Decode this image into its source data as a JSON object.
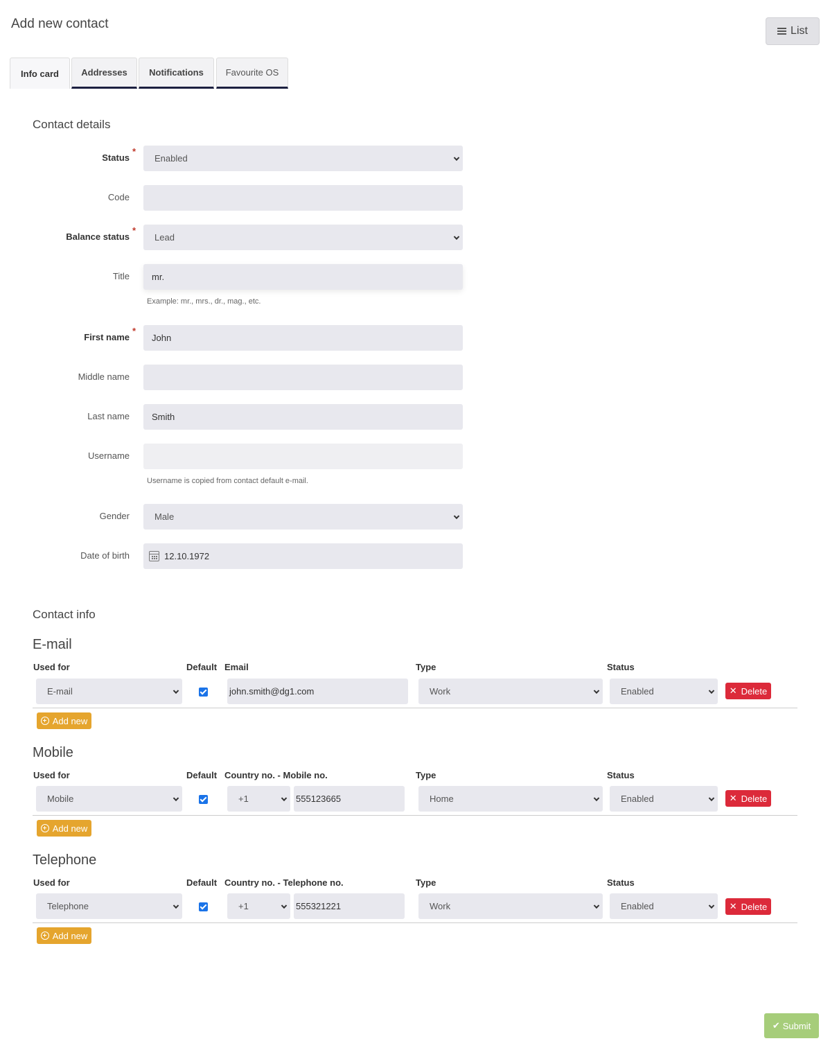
{
  "header": {
    "title": "Add new contact",
    "list_button": "List"
  },
  "tabs": [
    {
      "label": "Info card"
    },
    {
      "label": "Addresses"
    },
    {
      "label": "Notifications"
    },
    {
      "label": "Favourite OS"
    }
  ],
  "contact_details": {
    "title": "Contact details",
    "status": {
      "label": "Status",
      "value": "Enabled"
    },
    "code": {
      "label": "Code",
      "value": ""
    },
    "balance_status": {
      "label": "Balance status",
      "value": "Lead"
    },
    "title_field": {
      "label": "Title",
      "value": "mr.",
      "help": "Example: mr., mrs., dr., mag., etc."
    },
    "first_name": {
      "label": "First name",
      "value": "John"
    },
    "middle_name": {
      "label": "Middle name",
      "value": ""
    },
    "last_name": {
      "label": "Last name",
      "value": "Smith"
    },
    "username": {
      "label": "Username",
      "value": "",
      "help": "Username is copied from contact default e-mail."
    },
    "gender": {
      "label": "Gender",
      "value": "Male"
    },
    "dob": {
      "label": "Date of birth",
      "value": "12.10.1972"
    }
  },
  "contact_info": {
    "title": "Contact info",
    "email": {
      "title": "E-mail",
      "h_used": "Used for",
      "h_default": "Default",
      "h_value": "Email",
      "h_type": "Type",
      "h_status": "Status",
      "used_for": "E-mail",
      "value": "john.smith@dg1.com",
      "type": "Work",
      "status": "Enabled"
    },
    "mobile": {
      "title": "Mobile",
      "h_used": "Used for",
      "h_default": "Default",
      "h_value": "Country no. - Mobile no.",
      "h_type": "Type",
      "h_status": "Status",
      "used_for": "Mobile",
      "country": "+1",
      "value": "555123665",
      "type": "Home",
      "status": "Enabled"
    },
    "telephone": {
      "title": "Telephone",
      "h_used": "Used for",
      "h_default": "Default",
      "h_value": "Country no. - Telephone no.",
      "h_type": "Type",
      "h_status": "Status",
      "used_for": "Telephone",
      "country": "+1",
      "value": "555321221",
      "type": "Work",
      "status": "Enabled"
    },
    "delete_label": "Delete",
    "add_new_label": "Add new"
  },
  "footer": {
    "submit_label": "Submit"
  }
}
